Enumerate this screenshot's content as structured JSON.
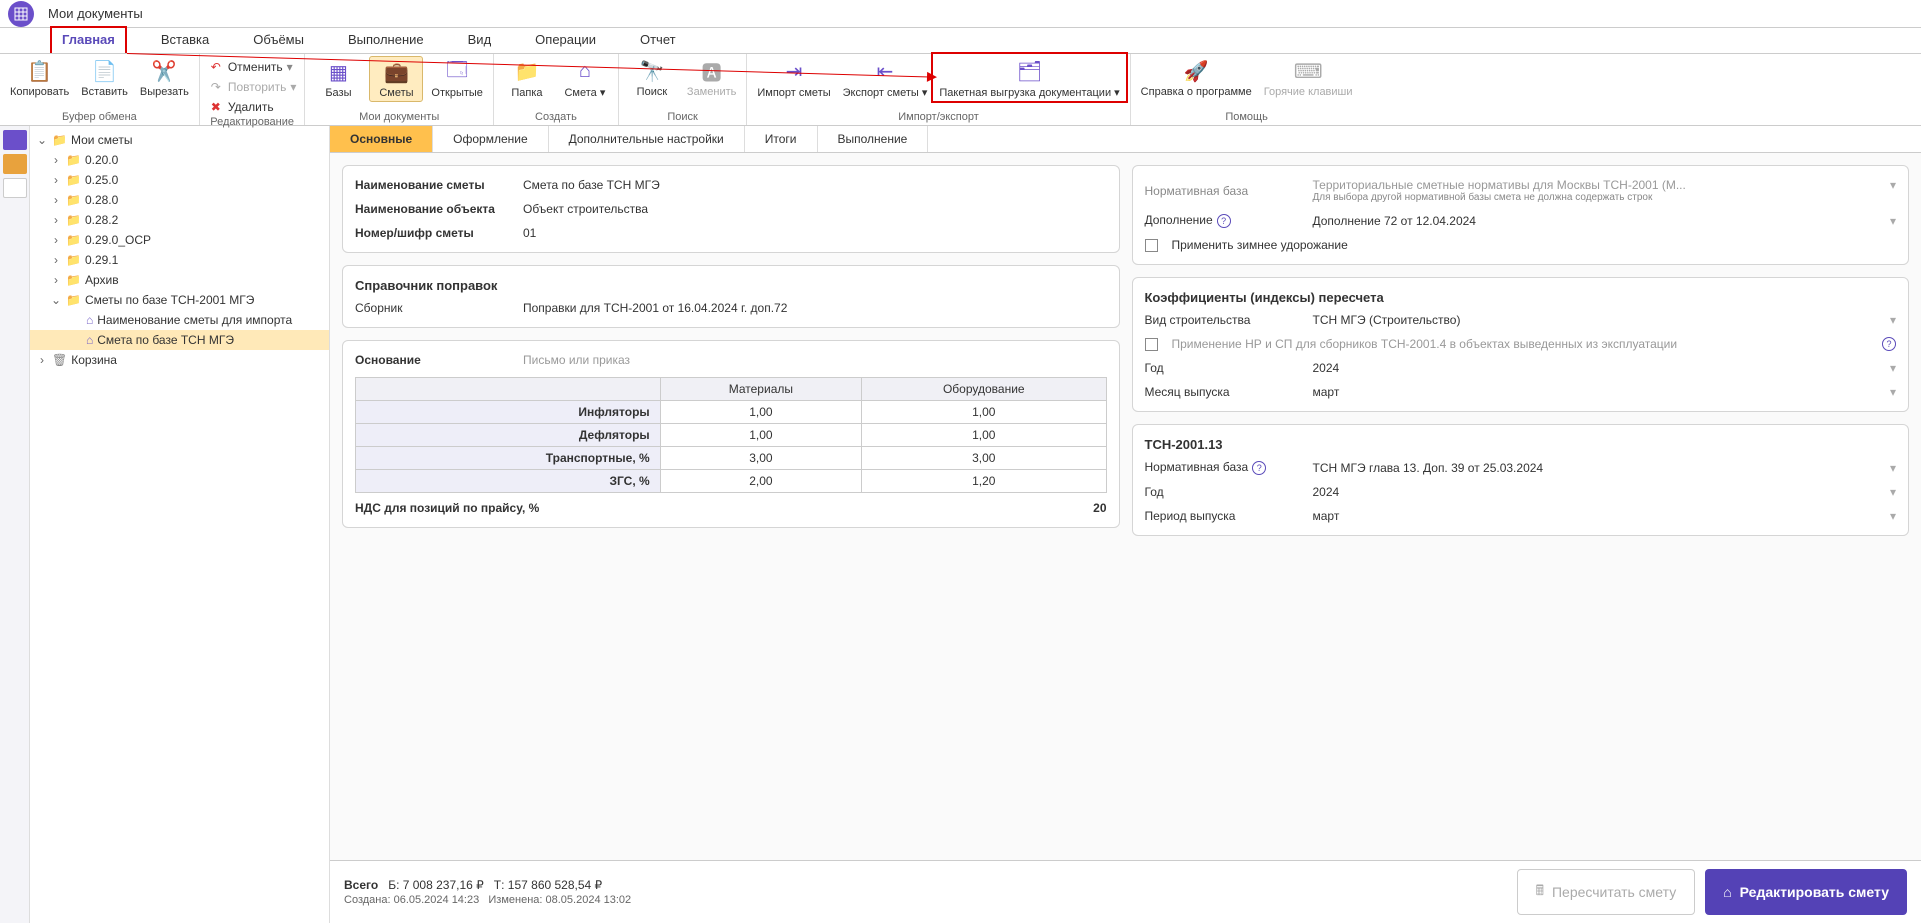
{
  "titlebar": {
    "title": "Мои документы"
  },
  "menu": [
    "Главная",
    "Вставка",
    "Объёмы",
    "Выполнение",
    "Вид",
    "Операции",
    "Отчет"
  ],
  "ribbon": {
    "groups": [
      {
        "label": "Буфер обмена",
        "buttons": [
          {
            "n": "Копировать"
          },
          {
            "n": "Вставить"
          },
          {
            "n": "Вырезать"
          }
        ]
      },
      {
        "label": "Редактирование",
        "small": [
          {
            "n": "Отменить"
          },
          {
            "n": "Повторить"
          },
          {
            "n": "Удалить"
          }
        ]
      },
      {
        "label": "Мои документы",
        "buttons": [
          {
            "n": "Базы"
          },
          {
            "n": "Сметы",
            "sel": true
          },
          {
            "n": "Открытые"
          }
        ]
      },
      {
        "label": "Создать",
        "buttons": [
          {
            "n": "Папка"
          },
          {
            "n": "Смета",
            "drop": true
          }
        ]
      },
      {
        "label": "Поиск",
        "buttons": [
          {
            "n": "Поиск"
          },
          {
            "n": "Заменить",
            "dis": true
          }
        ]
      },
      {
        "label": "Импорт/экспорт",
        "buttons": [
          {
            "n": "Импорт сметы"
          },
          {
            "n": "Экспорт сметы",
            "drop": true
          },
          {
            "n": "Пакетная выгрузка документации",
            "drop": true,
            "hl": true
          }
        ]
      },
      {
        "label": "Помощь",
        "buttons": [
          {
            "n": "Справка о программе"
          },
          {
            "n": "Горячие клавиши",
            "dis": true
          }
        ]
      }
    ]
  },
  "tree": [
    {
      "d": 0,
      "t": "Мои сметы",
      "ic": "folder",
      "exp": true
    },
    {
      "d": 1,
      "t": "0.20.0",
      "ic": "folder",
      "arr": ">"
    },
    {
      "d": 1,
      "t": "0.25.0",
      "ic": "folder",
      "arr": ">"
    },
    {
      "d": 1,
      "t": "0.28.0",
      "ic": "folder",
      "arr": ">"
    },
    {
      "d": 1,
      "t": "0.28.2",
      "ic": "folder",
      "arr": ">"
    },
    {
      "d": 1,
      "t": "0.29.0_ОСР",
      "ic": "folder",
      "arr": ">"
    },
    {
      "d": 1,
      "t": "0.29.1",
      "ic": "folder",
      "arr": ">"
    },
    {
      "d": 1,
      "t": "Архив",
      "ic": "folder",
      "arr": ">"
    },
    {
      "d": 1,
      "t": "Сметы по базе ТСН-2001 МГЭ",
      "ic": "folder",
      "exp": true
    },
    {
      "d": 2,
      "t": "Наименование сметы для импорта",
      "ic": "home"
    },
    {
      "d": 2,
      "t": "Смета по базе ТСН МГЭ",
      "ic": "home",
      "sel": true
    },
    {
      "d": 0,
      "t": "Корзина",
      "ic": "trash",
      "arr": ">"
    }
  ],
  "tabs": [
    "Основные",
    "Оформление",
    "Дополнительные настройки",
    "Итоги",
    "Выполнение"
  ],
  "form1": {
    "name_lab": "Наименование сметы",
    "name_val": "Смета по базе ТСН МГЭ",
    "obj_lab": "Наименование объекта",
    "obj_val": "Объект строительства",
    "num_lab": "Номер/шифр сметы",
    "num_val": "01"
  },
  "form2": {
    "title": "Справочник поправок",
    "sb_lab": "Сборник",
    "sb_val": "Поправки для ТСН-2001 от 16.04.2024 г. доп.72"
  },
  "form3": {
    "osn_lab": "Основание",
    "osn_ph": "Письмо или приказ",
    "cols": [
      "Материалы",
      "Оборудование"
    ],
    "rows": [
      {
        "h": "Инфляторы",
        "v": [
          "1,00",
          "1,00"
        ]
      },
      {
        "h": "Дефляторы",
        "v": [
          "1,00",
          "1,00"
        ]
      },
      {
        "h": "Транспортные, %",
        "v": [
          "3,00",
          "3,00"
        ]
      },
      {
        "h": "ЗГС, %",
        "v": [
          "2,00",
          "1,20"
        ]
      }
    ],
    "nds_lab": "НДС для позиций по прайсу, %",
    "nds_val": "20"
  },
  "r1": {
    "nb_lab": "Нормативная база",
    "nb_val": "Территориальные сметные нормативы для Москвы ТСН-2001 (М...",
    "nb_hint": "Для выбора другой нормативной базы смета не должна содержать строк",
    "dop_lab": "Дополнение",
    "dop_val": "Дополнение 72 от 12.04.2024",
    "zim": "Применить зимнее удорожание"
  },
  "r2": {
    "title": "Коэффициенты (индексы) пересчета",
    "vs_lab": "Вид строительства",
    "vs_val": "ТСН МГЭ (Строительство)",
    "nr": "Применение НР и СП для сборников ТСН-2001.4 в объектах выведенных из эксплуатации",
    "y_lab": "Год",
    "y_val": "2024",
    "m_lab": "Месяц выпуска",
    "m_val": "март"
  },
  "r3": {
    "title": "ТСН-2001.13",
    "nb_lab": "Нормативная база",
    "nb_val": "ТСН МГЭ глава 13. Доп. 39 от 25.03.2024",
    "y_lab": "Год",
    "y_val": "2024",
    "p_lab": "Период выпуска",
    "p_val": "март"
  },
  "footer": {
    "total_lab": "Всего",
    "b": "Б: 7 008 237,16 ₽",
    "t": "Т: 157 860 528,54 ₽",
    "created": "Создана: 06.05.2024 14:23",
    "changed": "Изменена: 08.05.2024 13:02",
    "recalc": "Пересчитать смету",
    "edit": "Редактировать смету"
  }
}
